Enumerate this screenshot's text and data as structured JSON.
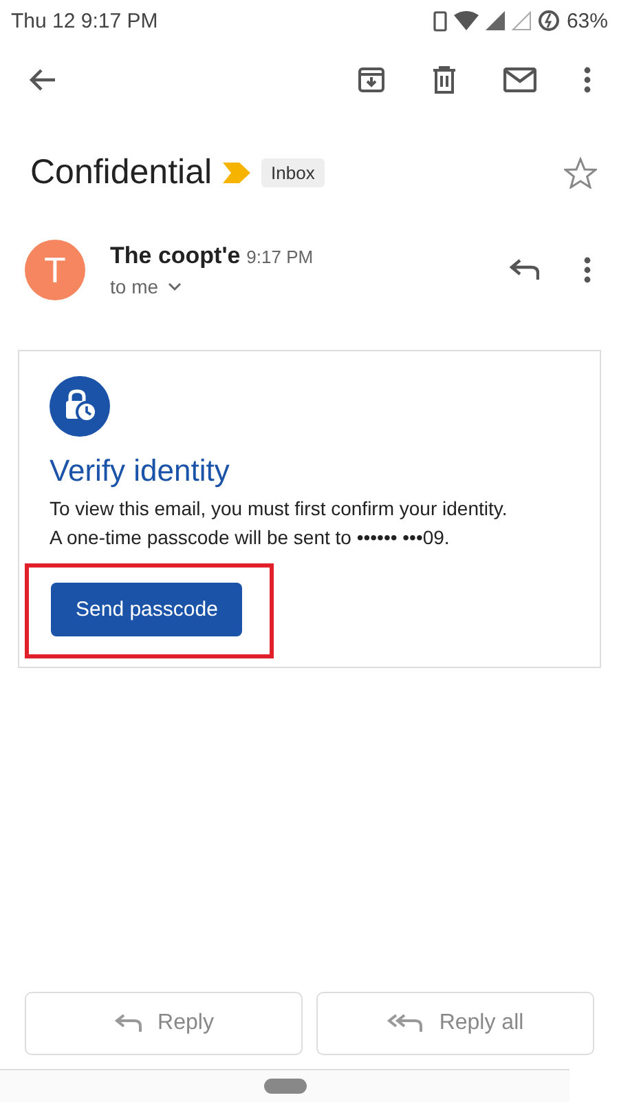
{
  "status_bar": {
    "time": "Thu 12 9:17 PM",
    "battery": "63%"
  },
  "subject": {
    "title": "Confidential",
    "important": true,
    "label": "Inbox",
    "starred": false
  },
  "message": {
    "avatar_letter": "T",
    "sender": "The coopt'e",
    "time": "9:17 PM",
    "recipient": "to me"
  },
  "card": {
    "title": "Verify identity",
    "lines": [
      "To view this email, you must first confirm your identity.",
      "A one-time passcode will be sent to •••••• •••09."
    ],
    "button": "Send passcode",
    "highlighted": true
  },
  "reply_buttons": [
    {
      "label": "Reply",
      "kind": "reply"
    },
    {
      "label": "Reply all",
      "kind": "reply_all"
    }
  ]
}
